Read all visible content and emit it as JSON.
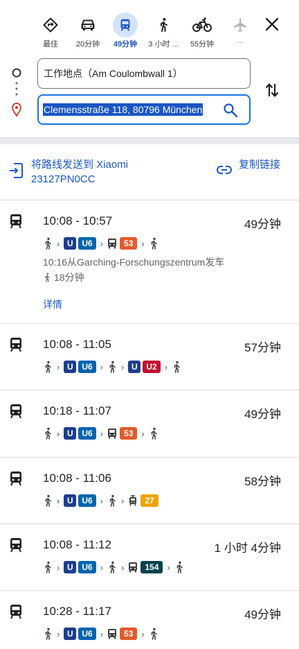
{
  "modes": [
    {
      "label": "最佳",
      "icon": "best-route-icon"
    },
    {
      "label": "20分钟",
      "icon": "car-icon"
    },
    {
      "label": "49分钟",
      "icon": "transit-icon"
    },
    {
      "label": "3 小时 ...",
      "icon": "walk-icon"
    },
    {
      "label": "55分钟",
      "icon": "bicycle-icon"
    },
    {
      "label": "—",
      "icon": "flight-icon"
    }
  ],
  "origin": "工作地点（Am Coulombwall 1）",
  "destination": "Clemensstraße 118, 80796 München",
  "share": {
    "send_label": "将路线发送到 Xiaomi 23127PN0CC",
    "copy_label": "复制链接"
  },
  "colors": {
    "U6": "#0065ae",
    "U2": "#c4112f",
    "bus53": "#e35b2c",
    "tram27": "#f0a30a",
    "bus154": "#06434c",
    "ubahn": "#1d3d8f",
    "accent": "#1a56c4"
  },
  "routes": [
    {
      "time": "10:08 - 10:57",
      "duration": "49分钟",
      "depart": "10:16从Garching-Forschungszentrum发车",
      "walk": "18分钟",
      "details": "详情",
      "u1": "U",
      "l1": "U6",
      "l2": "53"
    },
    {
      "time": "10:08 - 11:05",
      "duration": "57分钟",
      "u1": "U",
      "l1": "U6",
      "u2": "U",
      "l2": "U2"
    },
    {
      "time": "10:18 - 11:07",
      "duration": "49分钟",
      "u1": "U",
      "l1": "U6",
      "l2": "53"
    },
    {
      "time": "10:08 - 11:06",
      "duration": "58分钟",
      "u1": "U",
      "l1": "U6",
      "l2": "27"
    },
    {
      "time": "10:08 - 11:12",
      "duration": "1 小时 4分钟",
      "u1": "U",
      "l1": "U6",
      "l2": "154"
    },
    {
      "time": "10:28 - 11:17",
      "duration": "49分钟",
      "u1": "U",
      "l1": "U6",
      "l2": "53"
    }
  ]
}
